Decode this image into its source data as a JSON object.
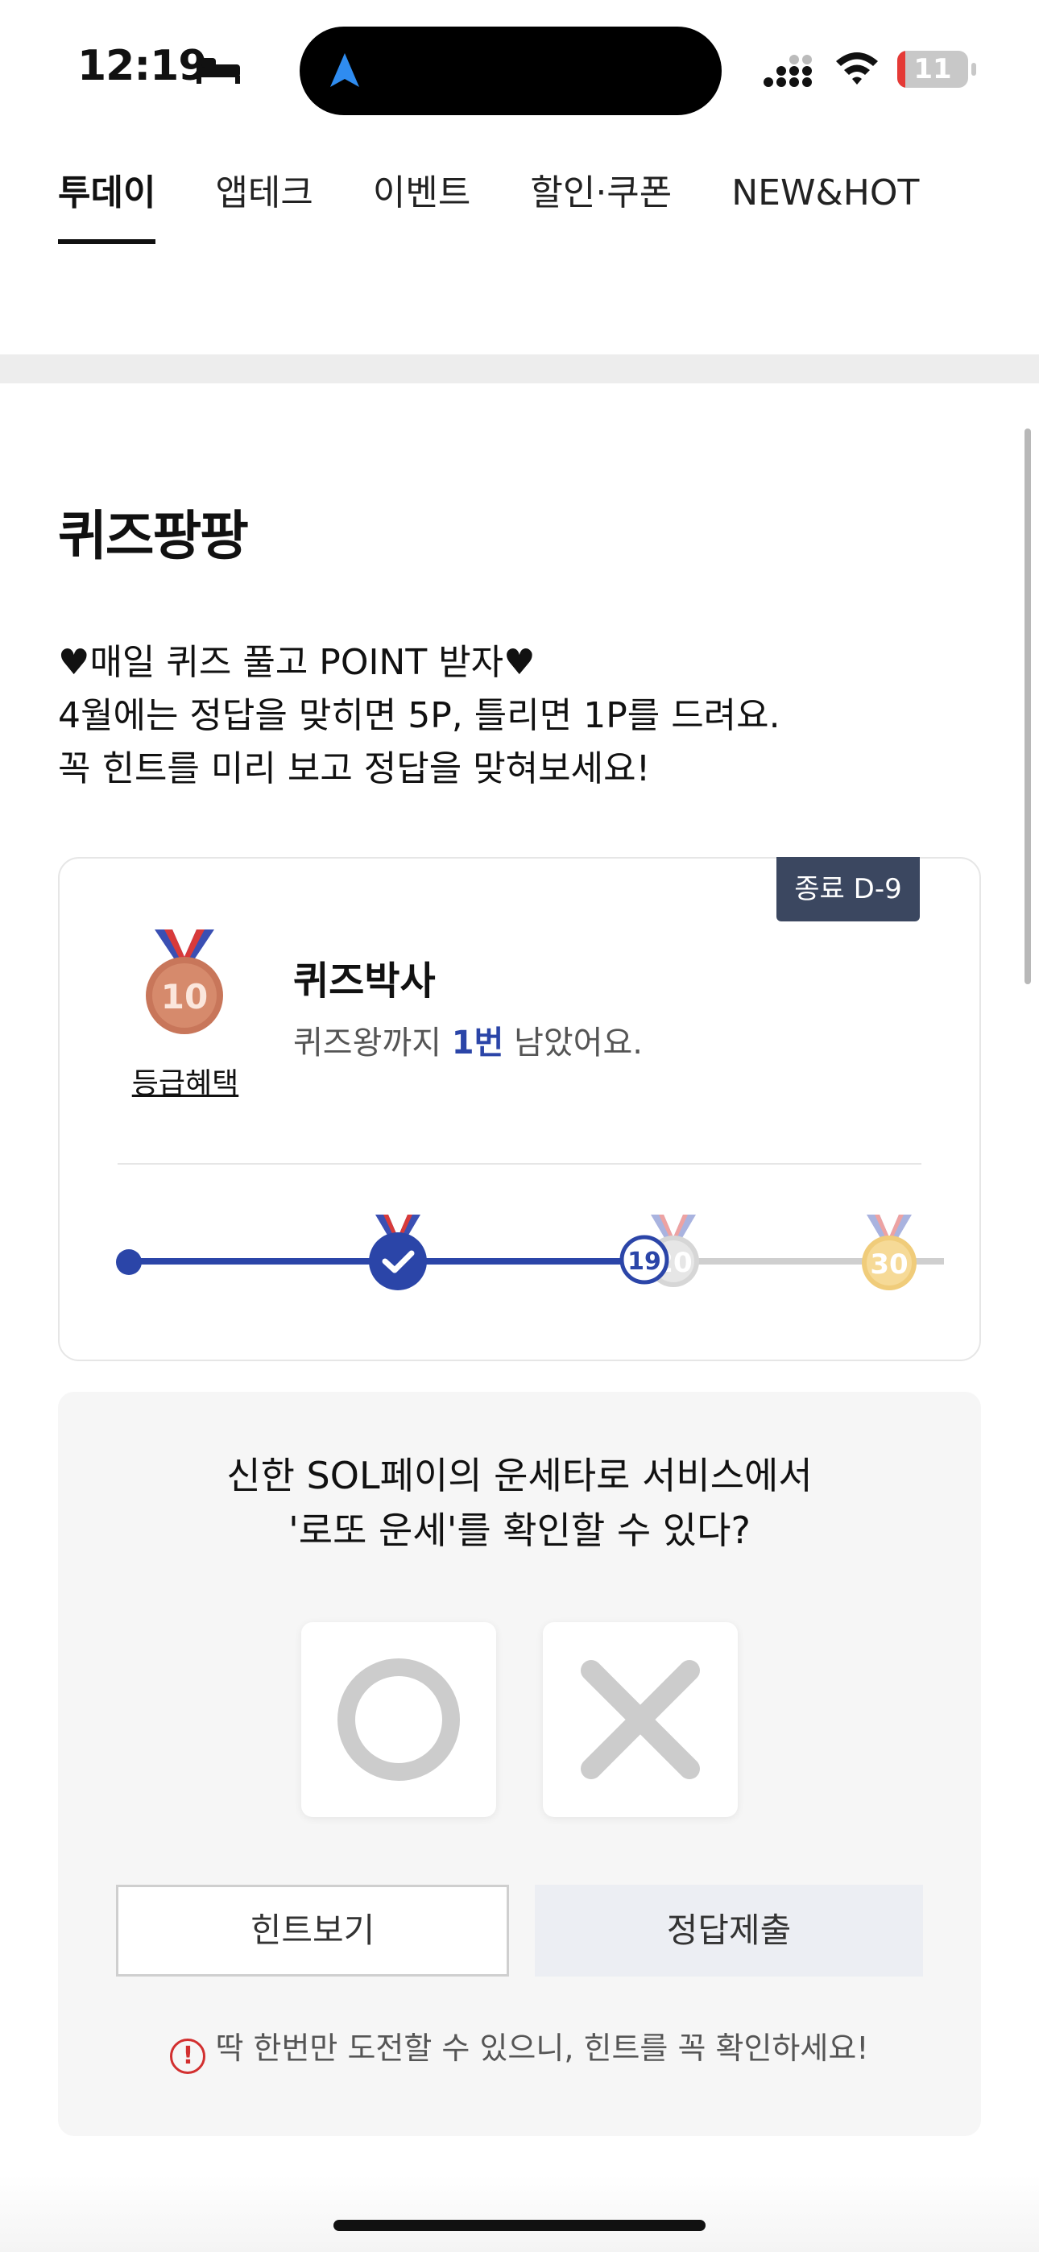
{
  "status_bar": {
    "time": "12:19",
    "battery": "11",
    "battery_level": 0.11,
    "icons": [
      "bed-icon",
      "navigation-arrow-icon",
      "cellular-signal-icon",
      "wifi-icon",
      "battery-icon"
    ]
  },
  "tabs": [
    {
      "label": "투데이",
      "active": true
    },
    {
      "label": "앱테크",
      "active": false
    },
    {
      "label": "이벤트",
      "active": false
    },
    {
      "label": "할인·쿠폰",
      "active": false
    },
    {
      "label": "NEW&HOT",
      "active": false
    }
  ],
  "section": {
    "title": "퀴즈팡팡",
    "intro": [
      "♥매일 퀴즈 풀고 POINT 받자♥",
      "4월에는 정답을 맞히면 5P, 틀리면 1P를 드려요.",
      "꼭 힌트를 미리 보고 정답을 맞혀보세요!"
    ]
  },
  "grade": {
    "dday": "종료 D-9",
    "medal_number": "10",
    "benefit_link": "등급혜택",
    "name": "퀴즈박사",
    "msg_prefix": "퀴즈왕까지 ",
    "msg_highlight": "1번",
    "msg_suffix": " 남았어요.",
    "progress": {
      "current": "19",
      "silver_medal": "20",
      "gold_medal": "30"
    }
  },
  "quiz": {
    "question_lines": [
      "신한 SOL페이의 운세타로 서비스에서",
      "'로또 운세'를 확인할 수 있다?"
    ],
    "hint_button": "힌트보기",
    "submit_button": "정답제출",
    "warning": "딱 한번만 도전할 수 있으니, 힌트를 꼭 확인하세요!"
  },
  "colors": {
    "accent": "#2b45a8",
    "badge_bg": "#3b4760",
    "warning": "#d22f2f",
    "bronze": "#c8765a",
    "silver": "#cfcfcf",
    "gold": "#f0cc7a"
  }
}
